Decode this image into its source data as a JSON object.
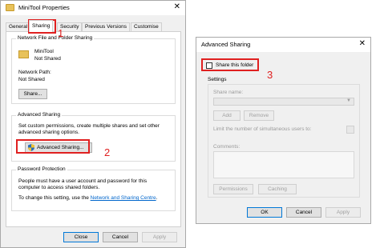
{
  "properties_window": {
    "title": "MiniTool Properties",
    "close_glyph": "✕",
    "tabs": [
      {
        "label": "General"
      },
      {
        "label": "Sharing"
      },
      {
        "label": "Security"
      },
      {
        "label": "Previous Versions"
      },
      {
        "label": "Customise"
      }
    ],
    "network_group": {
      "title": "Network File and Folder Sharing",
      "folder_name": "MiniTool",
      "folder_status": "Not Shared",
      "network_path_label": "Network Path:",
      "network_path_value": "Not Shared",
      "share_button": "Share..."
    },
    "advanced_group": {
      "title": "Advanced Sharing",
      "description_1": "Set custom permissions, create multiple shares and set other",
      "description_2": "advanced sharing options.",
      "button": "Advanced Sharing..."
    },
    "password_group": {
      "title": "Password Protection",
      "line_1": "People must have a user account and password for this",
      "line_2": "computer to access shared folders.",
      "line_3_prefix": "To change this setting, use the ",
      "link_text": "Network and Sharing Centre",
      "line_3_suffix": "."
    },
    "footer_buttons": {
      "close": "Close",
      "cancel": "Cancel",
      "apply": "Apply"
    }
  },
  "advanced_sharing_window": {
    "title": "Advanced Sharing",
    "close_glyph": "✕",
    "share_checkbox_label": "Share this folder",
    "share_checkbox_checked": false,
    "settings_title": "Settings",
    "share_name_label": "Share name:",
    "add_button": "Add",
    "remove_button": "Remove",
    "limit_label": "Limit the number of simultaneous users to:",
    "comments_label": "Comments:",
    "permissions_button": "Permissions",
    "caching_button": "Caching",
    "ok_button": "OK",
    "cancel_button": "Cancel",
    "apply_button": "Apply"
  },
  "annotations": {
    "step_1": "1",
    "step_2": "2",
    "step_3": "3",
    "highlight_color": "#e02020"
  },
  "colors": {
    "link": "#0066cc",
    "accent": "#0078d7",
    "folder": "#e8c25a"
  }
}
